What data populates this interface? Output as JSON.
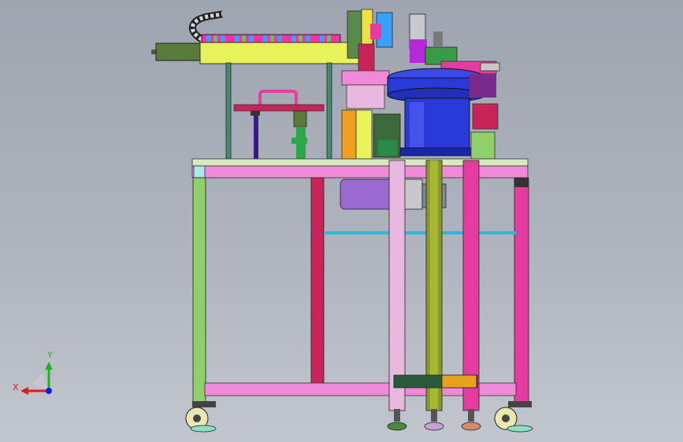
{
  "colors": {
    "background_top": "#9fa5b0",
    "background_bottom": "#c2c6ce",
    "frame_green": "#8fd06a",
    "frame_pink": "#f08ad8",
    "frame_magenta": "#e43ca0",
    "frame_crimson": "#c8245a",
    "beam_yellow": "#e8f25a",
    "bowl_blue": "#2a3ad8",
    "motor_purple": "#9a6ad0",
    "motor_olive": "#5a7a3a",
    "cyan_rod": "#2ab8d8",
    "axis_x": "#e01818",
    "axis_y": "#18b818",
    "axis_z": "#1818e0"
  },
  "triad": {
    "x_label": "X",
    "y_label": "Y"
  },
  "model": {
    "view": "front",
    "icons": [
      "vibratory-bowl-feeder",
      "linear-conveyor",
      "drag-chain",
      "aluminum-frame",
      "caster-wheel",
      "leveling-foot"
    ]
  }
}
